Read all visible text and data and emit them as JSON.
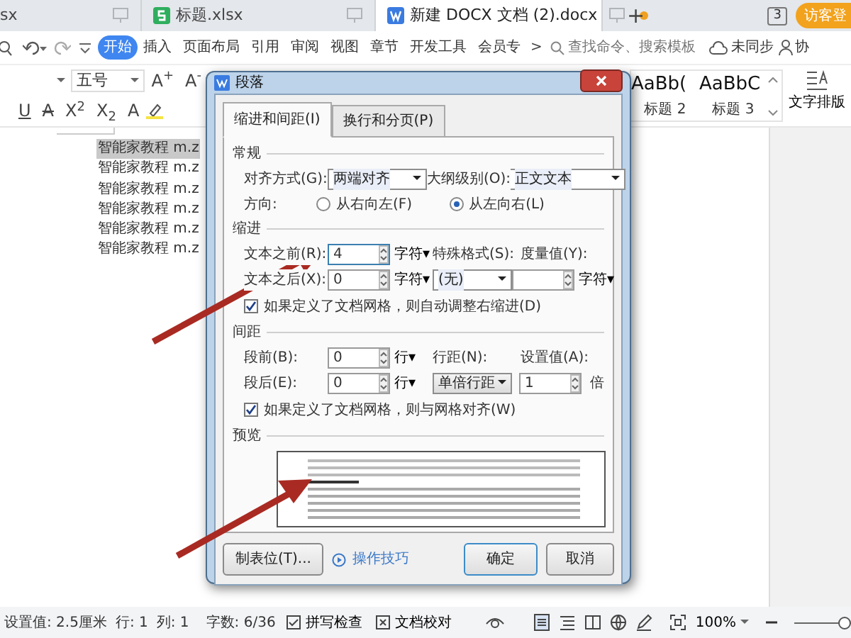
{
  "doc_tabs": [
    {
      "label": "sx",
      "kind": "none",
      "selected": false,
      "modified": false
    },
    {
      "label": "标题.xlsx",
      "kind": "sheet",
      "selected": false,
      "modified": false
    },
    {
      "label": "新建 DOCX 文档 (2).docx",
      "kind": "writer",
      "selected": true,
      "modified": true
    }
  ],
  "new_tab": "+",
  "account": {
    "badge": "3",
    "guest": "访客登"
  },
  "ribbon_tabs": [
    {
      "label": "开始",
      "selected": true
    },
    {
      "label": "插入",
      "selected": false
    },
    {
      "label": "页面布局",
      "selected": false
    },
    {
      "label": "引用",
      "selected": false
    },
    {
      "label": "审阅",
      "selected": false
    },
    {
      "label": "视图",
      "selected": false
    },
    {
      "label": "章节",
      "selected": false
    },
    {
      "label": "开发工具",
      "selected": false
    },
    {
      "label": "会员专",
      "selected": false
    }
  ],
  "ribbon_more": ">",
  "search": {
    "placeholder": "查找命令、搜索模板"
  },
  "sync": "未同步",
  "collab": "协",
  "toolbar": {
    "font_size": "五号",
    "size_buttons": [
      "A$^{+}$",
      "A$^{-}$"
    ],
    "format_buttons": [
      "U",
      "A",
      "X$^{2}$",
      "X$_{2}$",
      "A"
    ],
    "styles": [
      {
        "sample": "AaBb(",
        "name": "标题 2"
      },
      {
        "sample": "AaBbC",
        "name": "标题 3"
      }
    ],
    "layout_label": "文字排版"
  },
  "document": {
    "lines": [
      {
        "text": "智能家教程 m.z",
        "selected": true
      },
      {
        "text": "智能家教程 m.z",
        "selected": false
      },
      {
        "text": "智能家教程 m.z",
        "selected": false
      },
      {
        "text": "智能家教程 m.z",
        "selected": false
      },
      {
        "text": "智能家教程 m.z",
        "selected": false
      },
      {
        "text": "智能家教程 m.z",
        "selected": false
      }
    ]
  },
  "dialog": {
    "title": "段落",
    "tabs": [
      {
        "label": "缩进和间距(I)",
        "selected": true
      },
      {
        "label": "换行和分页(P)",
        "selected": false
      }
    ],
    "general": {
      "heading": "常规",
      "alignment": {
        "label": "对齐方式(G):",
        "value": "两端对齐"
      },
      "outline": {
        "label": "大纲级别(O):",
        "value": "正文文本"
      },
      "direction": {
        "label": "方向:",
        "options": [
          {
            "label": "从右向左(F)",
            "selected": false
          },
          {
            "label": "从左向右(L)",
            "selected": true
          }
        ]
      }
    },
    "indent": {
      "heading": "缩进",
      "before": {
        "label": "文本之前(R):",
        "value": "4",
        "unit": "字符▾"
      },
      "after": {
        "label": "文本之后(X):",
        "value": "0",
        "unit": "字符▾"
      },
      "special": {
        "label": "特殊格式(S):",
        "value": "(无)"
      },
      "measure": {
        "label": "度量值(Y):",
        "unit": "字符▾"
      },
      "auto_right": {
        "label": "如果定义了文档网格，则自动调整右缩进(D)",
        "checked": true
      }
    },
    "spacing": {
      "heading": "间距",
      "before": {
        "label": "段前(B):",
        "value": "0",
        "unit": "行▾"
      },
      "after": {
        "label": "段后(E):",
        "value": "0",
        "unit": "行▾"
      },
      "line": {
        "label": "行距(N):",
        "value": "单倍行距"
      },
      "setting": {
        "label": "设置值(A):",
        "value": "1",
        "unit": "倍"
      },
      "grid": {
        "label": "如果定义了文档网格，则与网格对齐(W)",
        "checked": true
      }
    },
    "preview": {
      "heading": "预览"
    },
    "tab_stops": "制表位(T)...",
    "tips": "操作技巧",
    "ok": "确定",
    "cancel": "取消"
  },
  "status_bar": {
    "items": [
      "设置值: 2.5厘米",
      "行: 1",
      "列: 1",
      "字数: 6/36"
    ],
    "spell": "拼写检查",
    "proof": "文档校对",
    "zoom": "100%",
    "zoom_slider": {
      "level": 1
    }
  }
}
